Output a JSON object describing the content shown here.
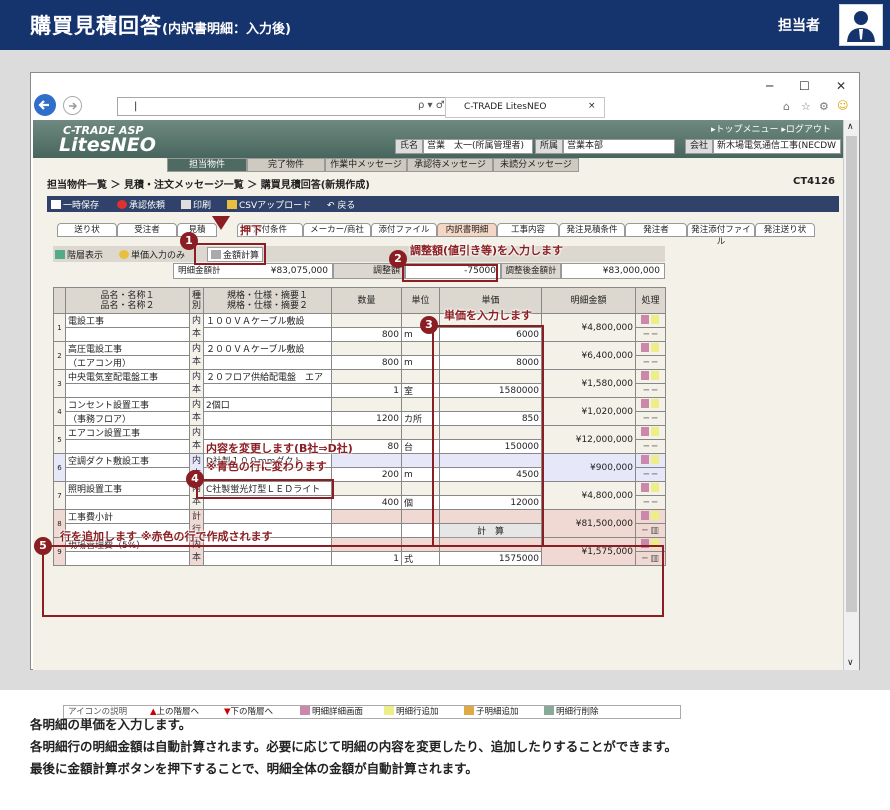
{
  "header": {
    "title": "購買見積回答",
    "subtitle": "(内訳書明細：入力後)",
    "role": "担当者"
  },
  "browser": {
    "address": "|",
    "tab_title": "C-TRADE LitesNEO",
    "minimize": "─",
    "maximize": "☐",
    "close": "✕",
    "search_sym": "ρ ▾ ♂"
  },
  "app": {
    "logo_top": "C-TRADE ASP",
    "logo_main": "LitesNEO",
    "top_menu": "▸トップメニュー ▸ログアウト",
    "name_label": "氏名",
    "name_value": "営業　太一(所属管理者)",
    "dept_label": "所属",
    "dept_value": "営業本部",
    "company_label": "会社",
    "company_value": "新木場電気通信工事(NECDW",
    "main_tabs": [
      "担当物件",
      "完了物件",
      "作業中メッセージ",
      "承認待メッセージ",
      "未読分メッセージ"
    ],
    "breadcrumb": "担当物件一覧 ＞ 見積・注文メッセージ一覧 ＞ 購買見積回答(新規作成)",
    "screen_id": "CT4126",
    "toolbar": [
      "一時保存",
      "承認依頼",
      "印刷",
      "CSVアップロード",
      "戻る"
    ],
    "sub_tabs": [
      "送り状",
      "受注者",
      "見積",
      "添付条件",
      "メーカー/商社",
      "添付ファイル",
      "内訳書明細",
      "工事内容",
      "発注見積条件",
      "発注者",
      "発注添付ファイル",
      "発注送り状"
    ],
    "hierarchy_label": "階層表示",
    "unit_input_label": "単価入力のみ",
    "calc_button": "金額計算",
    "detail_total_label": "明細金額計",
    "detail_total": "¥83,075,000",
    "adjust_label": "調整額",
    "adjust_value": "-75000",
    "after_adjust_label": "調整後金額計",
    "after_adjust": "¥83,000,000",
    "columns": {
      "name": "品名・名称１\n品名・名称２",
      "cat": "種別",
      "spec": "規格・仕様・摘要１\n規格・仕様・摘要２",
      "qty": "数量",
      "unit": "単位",
      "price": "単価",
      "amount": "明細金額",
      "op": "処理"
    },
    "rows": [
      {
        "no": "1",
        "name1": "電設工事",
        "name2": "",
        "cat": "内本",
        "spec1": "１００ＶＡケーブル敷設",
        "spec2": "",
        "qty": "800",
        "unit": "m",
        "price": "6000",
        "amount": "¥4,800,000",
        "style": ""
      },
      {
        "no": "2",
        "name1": "高圧電設工事",
        "name2": "（エアコン用）",
        "cat": "内本",
        "spec1": "２００ＶＡケーブル敷設",
        "spec2": "",
        "qty": "800",
        "unit": "m",
        "price": "8000",
        "amount": "¥6,400,000",
        "style": ""
      },
      {
        "no": "3",
        "name1": "中央電気室配電盤工事",
        "name2": "",
        "cat": "内本",
        "spec1": "２０フロア供給配電盤　エア",
        "spec2": "",
        "qty": "1",
        "unit": "室",
        "price": "1580000",
        "amount": "¥1,580,000",
        "style": ""
      },
      {
        "no": "4",
        "name1": "コンセント設置工事",
        "name2": "（事務フロア）",
        "cat": "内本",
        "spec1": "2個口",
        "spec2": "",
        "qty": "1200",
        "unit": "カ所",
        "price": "850",
        "amount": "¥1,020,000",
        "style": ""
      },
      {
        "no": "5",
        "name1": "エアコン設置工事",
        "name2": "",
        "cat": "内本",
        "spec1": "",
        "spec2": "",
        "qty": "80",
        "unit": "台",
        "price": "150000",
        "amount": "¥12,000,000",
        "style": ""
      },
      {
        "no": "6",
        "name1": "空調ダクト敷設工事",
        "name2": "",
        "cat": "内本",
        "spec1": "D社製１００mmダクト",
        "spec2": "",
        "qty": "200",
        "unit": "m",
        "price": "4500",
        "amount": "¥900,000",
        "style": "blue"
      },
      {
        "no": "7",
        "name1": "照明設置工事",
        "name2": "",
        "cat": "内本",
        "spec1": "C社製蛍光灯型ＬＥＤライト",
        "spec2": "",
        "qty": "400",
        "unit": "個",
        "price": "12000",
        "amount": "¥4,800,000",
        "style": ""
      },
      {
        "no": "8",
        "name1": "工事費小計",
        "name2": "",
        "cat": "計行",
        "spec1": "",
        "spec2": "",
        "qty": "",
        "unit": "",
        "price": "計　算",
        "amount": "¥81,500,000",
        "style": "pink"
      },
      {
        "no": "9",
        "name1": "現場管理費（5%）",
        "name2": "",
        "cat": "内本",
        "spec1": "",
        "spec2": "",
        "qty": "1",
        "unit": "式",
        "price": "1575000",
        "amount": "¥1,575,000",
        "style": "pink"
      }
    ],
    "footer_items": [
      "アイコンの説明",
      "上の階層へ",
      "下の階層へ",
      "明細詳細画面",
      "明細行追加",
      "子明細追加",
      "明細行削除"
    ]
  },
  "annotations": {
    "a1": "押下",
    "a2": "調整額(値引き等)を入力します",
    "a3": "単価を入力します",
    "a4a": "内容を変更します(B社⇒D社)",
    "a4b": "※青色の行に変わります",
    "a5": "行を追加します ※赤色の行で作成されます",
    "n1": "1",
    "n2": "2",
    "n3": "3",
    "n4": "4",
    "n5": "5"
  },
  "footer_text": [
    "各明細の単価を入力します。",
    "各明細行の明細金額は自動計算されます。必要に応じて明細の内容を変更したり、追加したりすることができます。",
    "最後に金額計算ボタンを押下することで、明細全体の金額が自動計算されます。"
  ],
  "colors": {
    "header": "#15336d",
    "accent": "#8b1e22"
  }
}
